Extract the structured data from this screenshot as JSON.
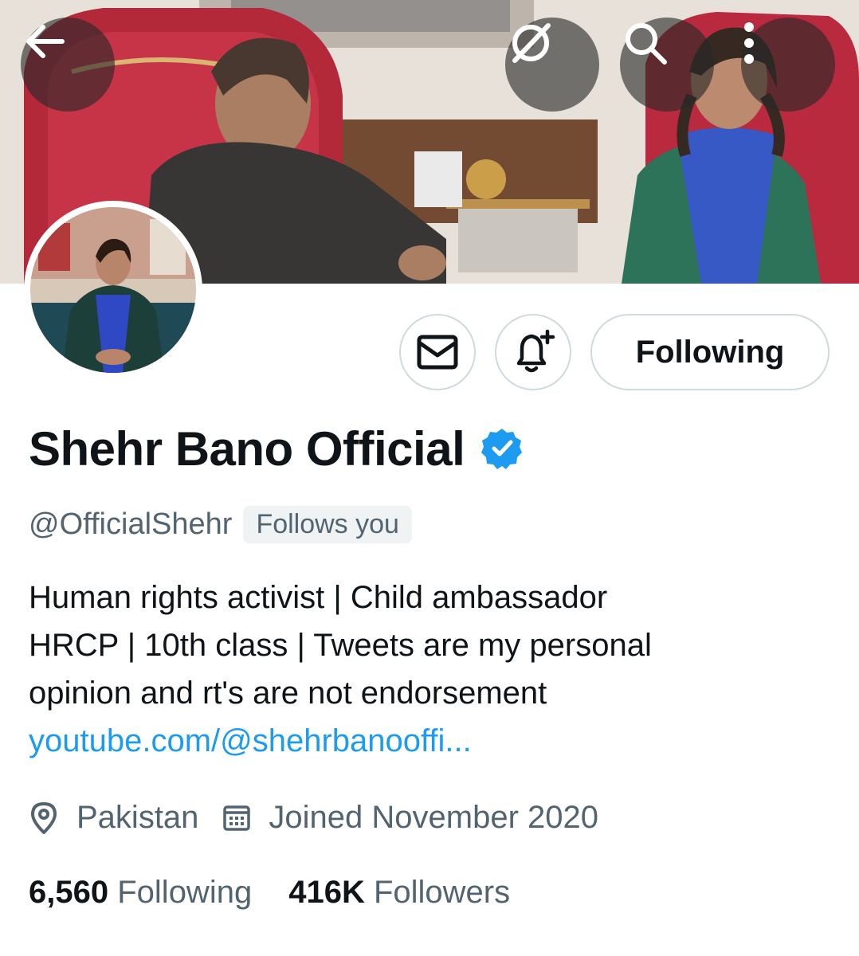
{
  "header": {
    "back_icon": "arrow-left-icon",
    "grok_icon": "slashed-circle-icon",
    "search_icon": "search-icon",
    "more_icon": "more-vertical-icon"
  },
  "profile": {
    "display_name": "Shehr Bano Official",
    "verified_icon": "verified-badge-icon",
    "verified_color": "#1d9bf0",
    "handle": "@OfficialShehr",
    "follows_you": "Follows you",
    "bio_lines": [
      "Human rights activist | Child ambassador",
      "HRCP | 10th class | Tweets are my personal",
      "opinion and rt's are not endorsement"
    ],
    "link": "youtube.com/@shehrbanooffi...",
    "location": "Pakistan",
    "joined": "Joined November 2020",
    "following_count": "6,560",
    "following_label": "Following",
    "followers_count": "416K",
    "followers_label": "Followers"
  },
  "actions": {
    "message_icon": "envelope-icon",
    "notify_icon": "bell-plus-icon",
    "follow_state_label": "Following"
  },
  "colors": {
    "accent": "#1d9bf0",
    "secondary_text": "#536471",
    "border": "#cfd9de"
  }
}
